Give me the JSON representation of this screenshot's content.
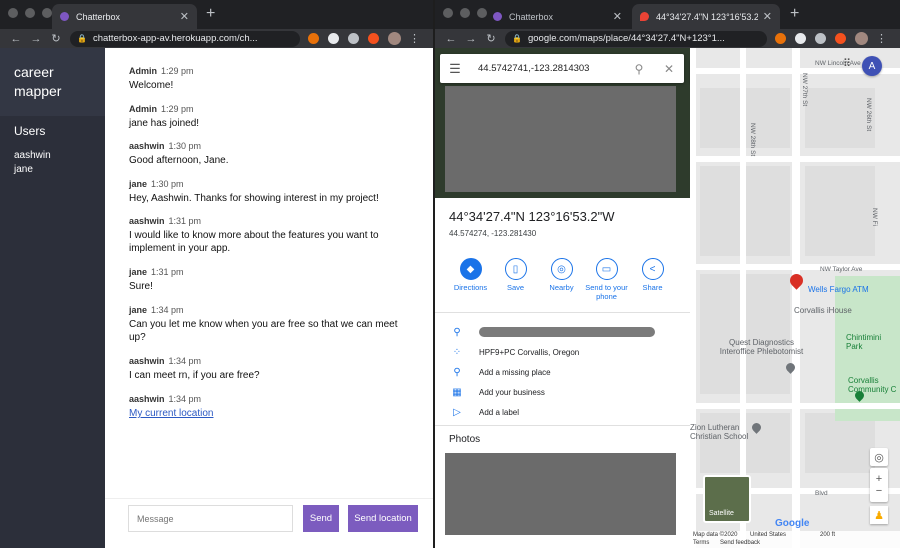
{
  "left_window": {
    "tab_title": "Chatterbox",
    "url": "chatterbox-app-av.herokuapp.com/ch..."
  },
  "right_window": {
    "tabs": [
      {
        "title": "Chatterbox"
      },
      {
        "title": "44°34'27.4\"N 123°16'53.2\"W"
      }
    ],
    "url": "google.com/maps/place/44°34'27.4\"N+123°1...",
    "profile_initial": "A"
  },
  "app": {
    "title": "career mapper",
    "users_heading": "Users",
    "users": [
      "aashwin",
      "jane"
    ]
  },
  "messages": [
    {
      "author": "Admin",
      "time": "1:29 pm",
      "text": "Welcome!"
    },
    {
      "author": "Admin",
      "time": "1:29 pm",
      "text": "jane has joined!"
    },
    {
      "author": "aashwin",
      "time": "1:30 pm",
      "text": "Good afternoon, Jane."
    },
    {
      "author": "jane",
      "time": "1:30 pm",
      "text": "Hey, Aashwin. Thanks for showing interest in my project!"
    },
    {
      "author": "aashwin",
      "time": "1:31 pm",
      "text": "I would like to know more about the features you want to implement in your app."
    },
    {
      "author": "jane",
      "time": "1:31 pm",
      "text": "Sure!"
    },
    {
      "author": "jane",
      "time": "1:34 pm",
      "text": "Can you let me know when you are free so that we can meet up?"
    },
    {
      "author": "aashwin",
      "time": "1:34 pm",
      "text": "I can meet rn, if you are free?"
    },
    {
      "author": "aashwin",
      "time": "1:34 pm",
      "link_text": "My current location"
    }
  ],
  "compose": {
    "placeholder": "Message",
    "send_label": "Send",
    "send_location_label": "Send location"
  },
  "maps": {
    "search_value": "44.5742741,-123.2814303",
    "place_title": "44°34'27.4\"N 123°16'53.2\"W",
    "coords": "44.574274, -123.281430",
    "actions": [
      "Directions",
      "Save",
      "Nearby",
      "Send to your phone",
      "Share"
    ],
    "plus_code": "HPF9+PC Corvallis, Oregon",
    "add_missing_place": "Add a missing place",
    "add_business": "Add your business",
    "add_label": "Add a label",
    "photos_heading": "Photos",
    "satellite_label": "Satellite",
    "map_footer": {
      "data": "Map data ©2020",
      "country": "United States",
      "terms": "Terms",
      "feedback": "Send feedback",
      "scale": "200 ft"
    },
    "map_labels": {
      "nw_lincoln": "NW Lincoln Ave",
      "nw_27th": "NW 27th St",
      "nw_26th": "NW 26th St",
      "nw_28th": "NW 28th St",
      "nw_fi": "NW Fi",
      "nw_taylor": "NW Taylor Ave",
      "wells_fargo": "Wells Fargo ATM",
      "corvallis_ihouse": "Corvallis iHouse",
      "chintimini": "Chintimini Park",
      "community": "Corvallis Community C",
      "quest": "Quest Diagnostics Interoffice Phlebotomist",
      "zion": "Zion Lutheran Christian School",
      "blvd": "Blvd",
      "google": "Google"
    }
  }
}
